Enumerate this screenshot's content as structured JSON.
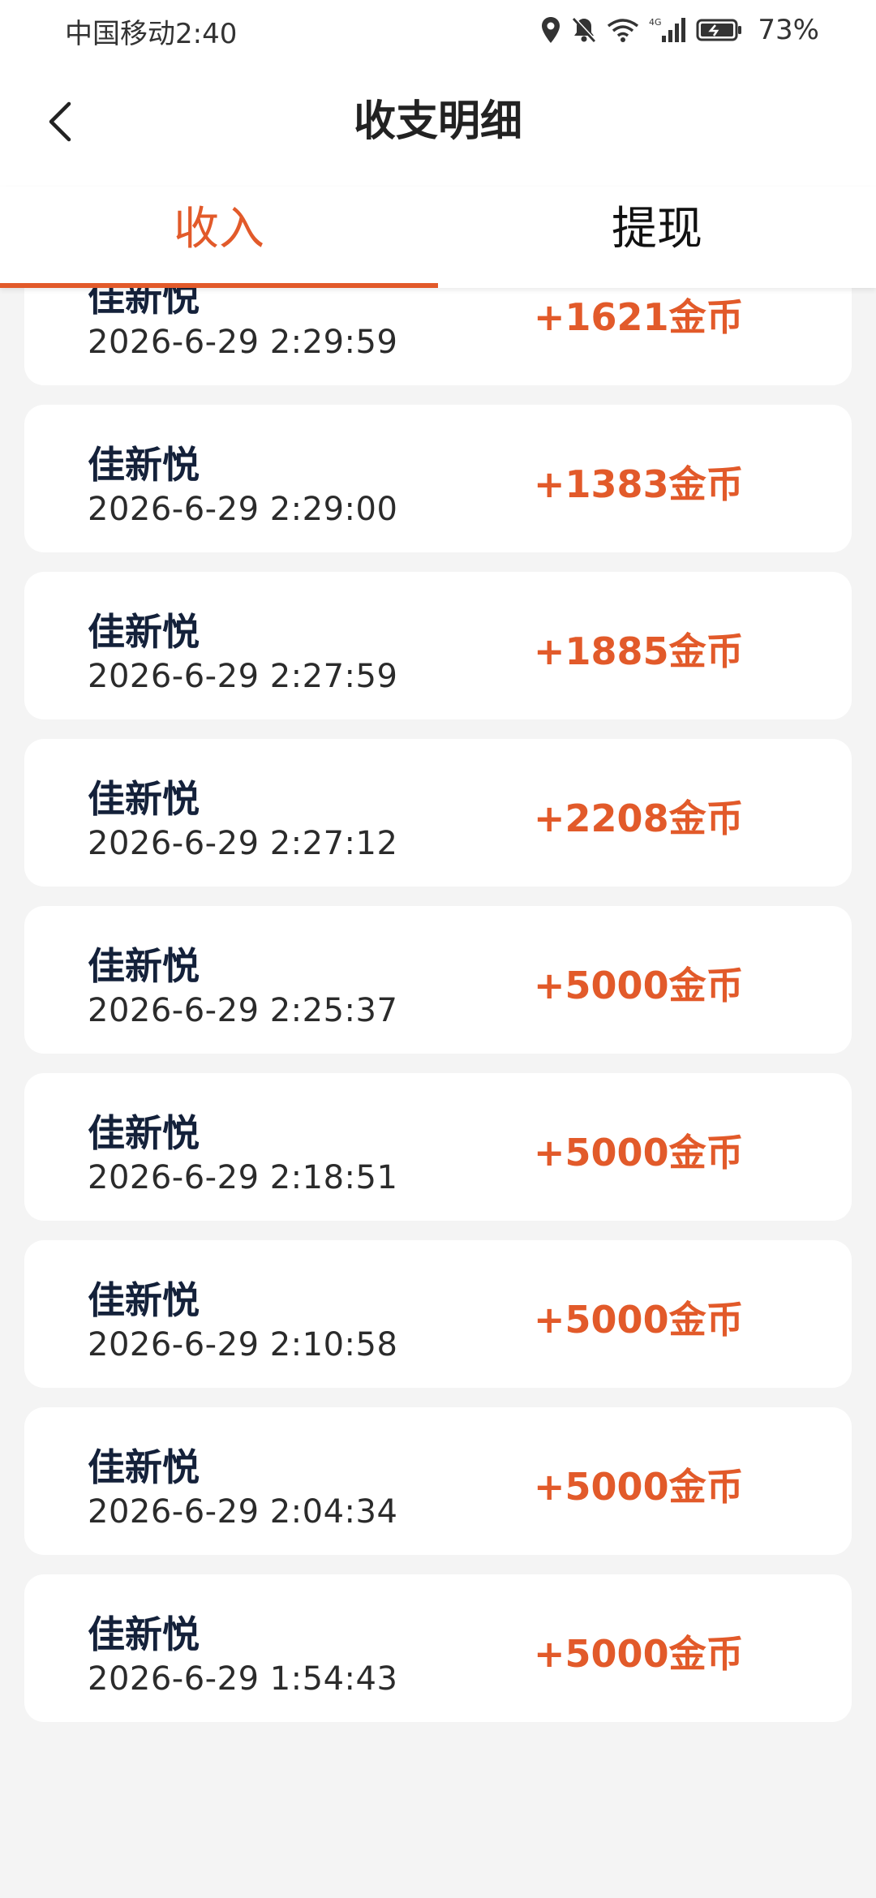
{
  "status": {
    "carrier_time": "中国移动2:40",
    "battery": "73%",
    "icons": [
      "location-icon",
      "bell-muted-icon",
      "wifi-icon",
      "signal-4g-icon",
      "battery-icon"
    ]
  },
  "header": {
    "title": "收支明细",
    "back_icon": "chevron-left-icon"
  },
  "tabs": [
    {
      "label": "收入",
      "active": true
    },
    {
      "label": "提现",
      "active": false
    }
  ],
  "colors": {
    "accent": "#e25a2a",
    "text_dark": "#14213a",
    "background": "#f4f4f4"
  },
  "records": [
    {
      "name": "佳新悦",
      "time": "2026-6-29 2:29:59",
      "amount": "+1621金币"
    },
    {
      "name": "佳新悦",
      "time": "2026-6-29 2:29:00",
      "amount": "+1383金币"
    },
    {
      "name": "佳新悦",
      "time": "2026-6-29 2:27:59",
      "amount": "+1885金币"
    },
    {
      "name": "佳新悦",
      "time": "2026-6-29 2:27:12",
      "amount": "+2208金币"
    },
    {
      "name": "佳新悦",
      "time": "2026-6-29 2:25:37",
      "amount": "+5000金币"
    },
    {
      "name": "佳新悦",
      "time": "2026-6-29 2:18:51",
      "amount": "+5000金币"
    },
    {
      "name": "佳新悦",
      "time": "2026-6-29 2:10:58",
      "amount": "+5000金币"
    },
    {
      "name": "佳新悦",
      "time": "2026-6-29 2:04:34",
      "amount": "+5000金币"
    },
    {
      "name": "佳新悦",
      "time": "2026-6-29 1:54:43",
      "amount": "+5000金币"
    }
  ]
}
